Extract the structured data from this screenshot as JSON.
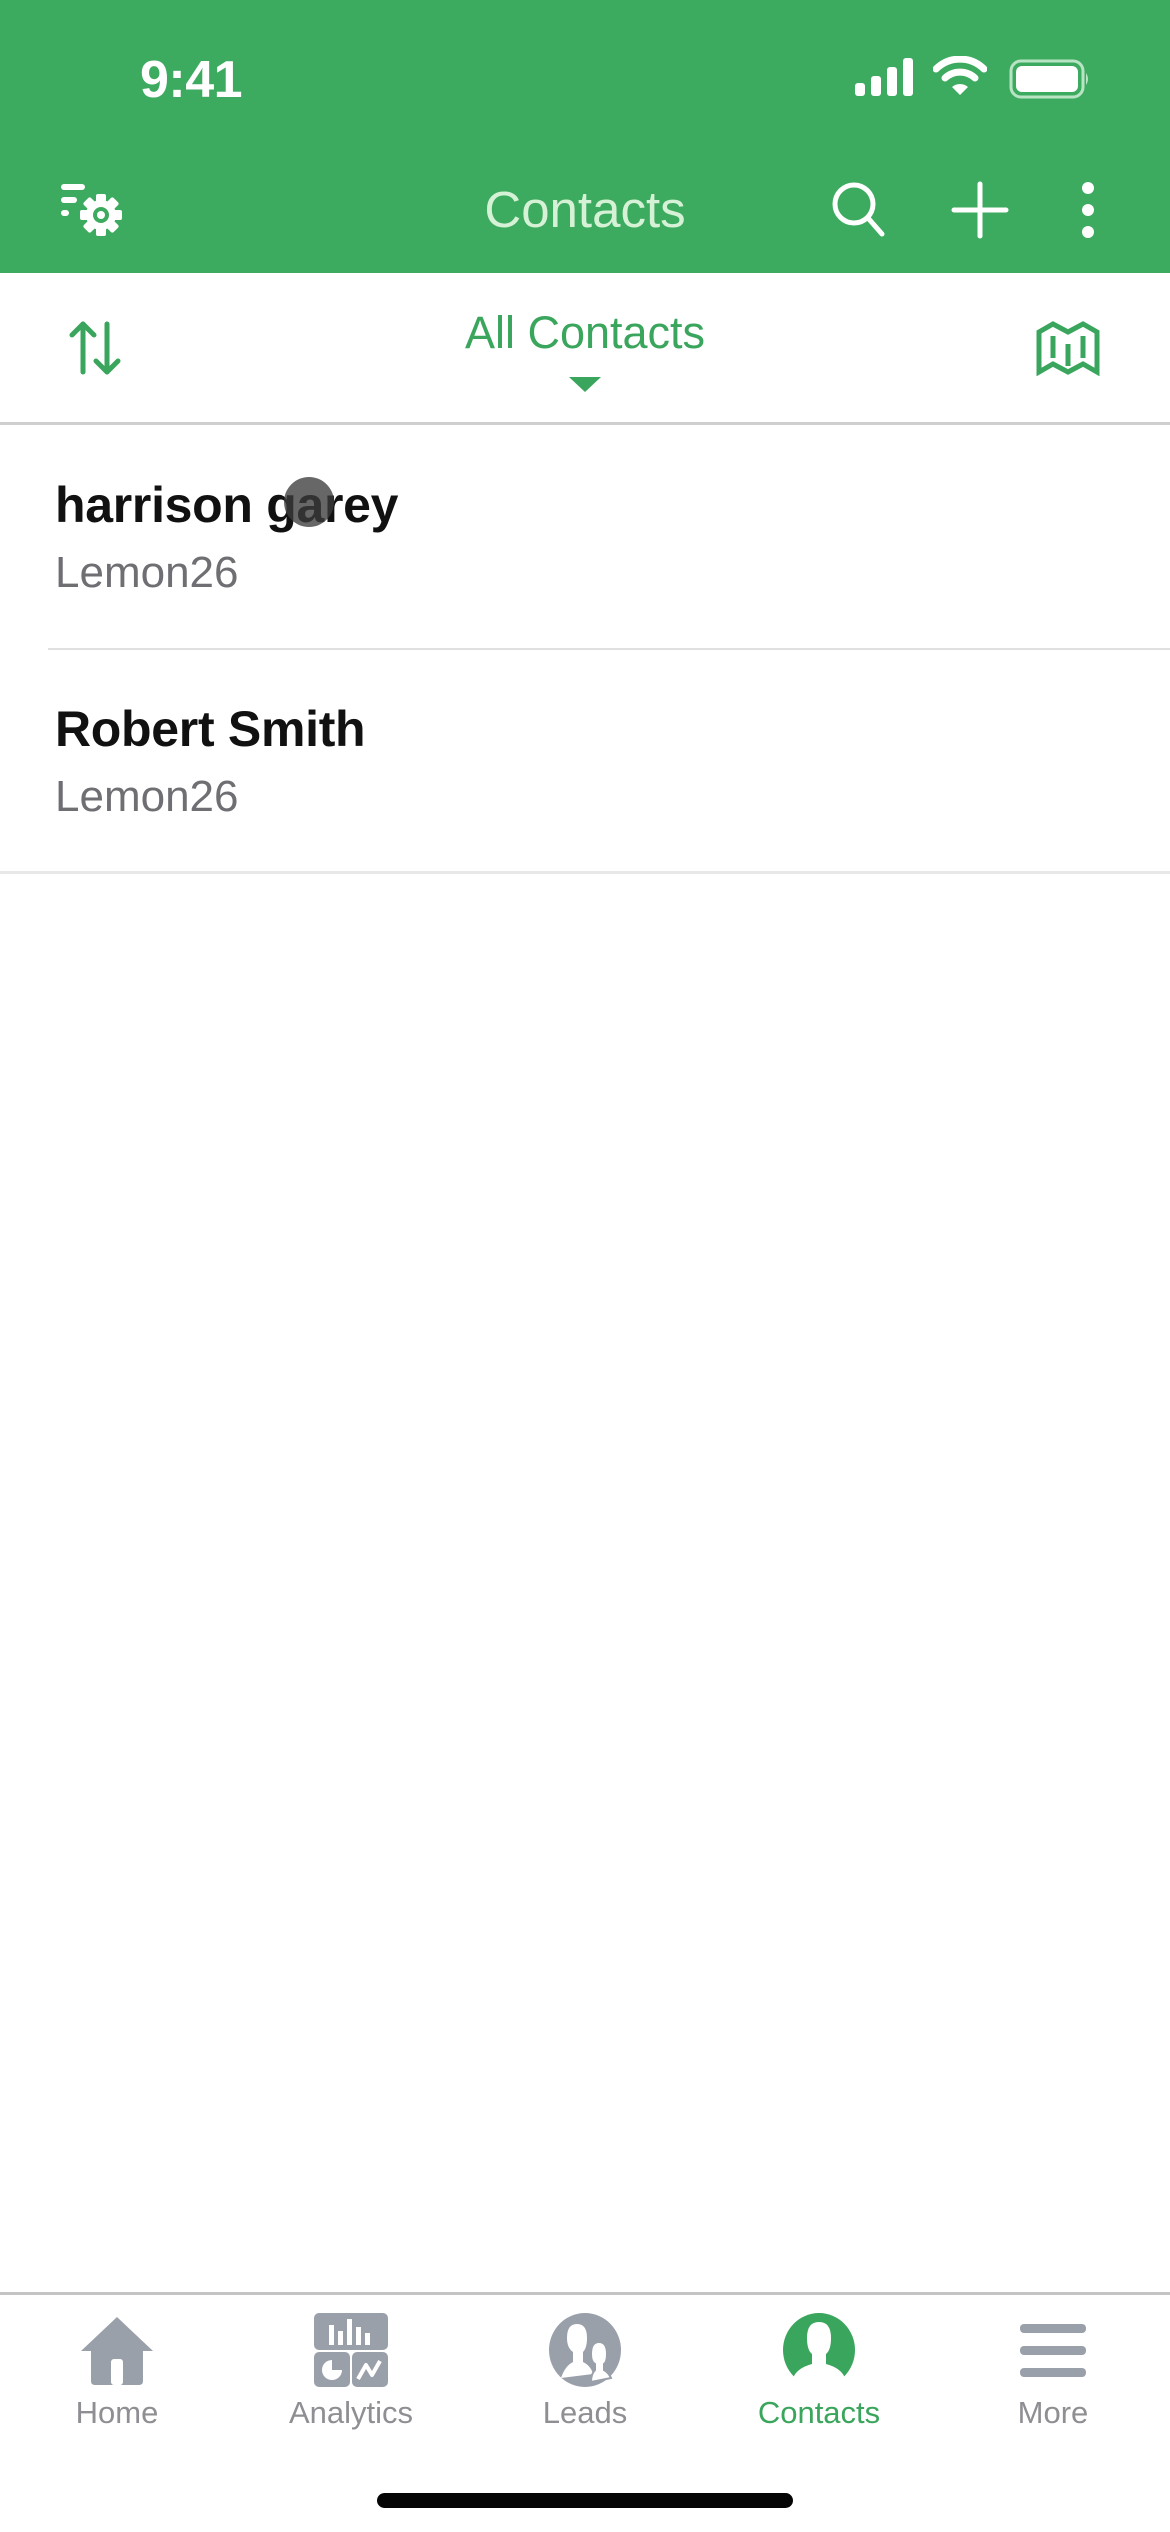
{
  "status_bar": {
    "time": "9:41",
    "icons": [
      "cellular-signal-icon",
      "wifi-icon",
      "battery-icon"
    ]
  },
  "nav_bar": {
    "title": "Contacts",
    "left_icon": "filter-settings-icon",
    "right_icons": [
      "search-icon",
      "plus-icon",
      "more-vertical-icon"
    ]
  },
  "filter_bar": {
    "sort_icon": "sort-arrows-icon",
    "view_selected": "All Contacts",
    "map_icon": "map-icon"
  },
  "contacts": [
    {
      "name": "harrison garey",
      "company": "Lemon26"
    },
    {
      "name": "Robert Smith",
      "company": "Lemon26"
    }
  ],
  "tab_bar": {
    "active": "Contacts",
    "tabs": [
      {
        "label": "Home",
        "icon": "home-icon"
      },
      {
        "label": "Analytics",
        "icon": "analytics-icon"
      },
      {
        "label": "Leads",
        "icon": "leads-icon"
      },
      {
        "label": "Contacts",
        "icon": "contacts-icon"
      },
      {
        "label": "More",
        "icon": "hamburger-menu-icon"
      }
    ]
  },
  "colors": {
    "brand_green": "#3dab5f",
    "accent_green": "#3aa55c",
    "title_tint": "#d6f2d6",
    "inactive_gray": "#8e8e93"
  }
}
